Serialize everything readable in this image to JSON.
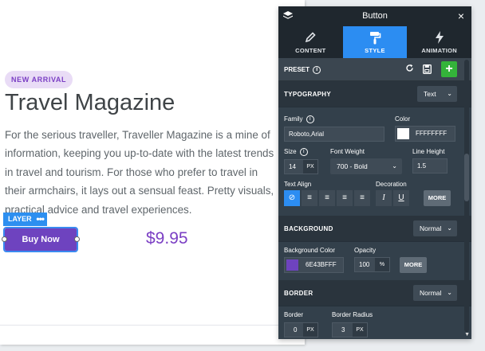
{
  "canvas": {
    "badge": "NEW ARRIVAL",
    "title": "Travel Magazine",
    "description": "For the serious traveller, Traveller Magazine is a mine of information, keeping you up-to-date with the latest trends in travel and tourism. For those who prefer to travel in their armchairs, it lays out a sensual feast. Pretty visuals, practical advice and travel experiences.",
    "layer_label": "LAYER",
    "layer_dots": "•••",
    "button_label": "Buy Now",
    "price": "$9.95"
  },
  "panel": {
    "title": "Button",
    "close_icon": "×",
    "tabs": [
      {
        "label": "CONTENT",
        "icon": "pencil-icon"
      },
      {
        "label": "STYLE",
        "icon": "paint-roller-icon",
        "active": true
      },
      {
        "label": "ANIMATION",
        "icon": "bolt-icon"
      }
    ],
    "preset": {
      "label": "PRESET"
    },
    "typography": {
      "label": "TYPOGRAPHY",
      "mode": "Text",
      "family_label": "Family",
      "family_value": "Roboto,Arial",
      "color_label": "Color",
      "color_value": "FFFFFFFF",
      "color_hex": "#FFFFFF",
      "size_label": "Size",
      "size_value": "14",
      "size_unit": "PX",
      "weight_label": "Font Weight",
      "weight_value": "700 - Bold",
      "lineheight_label": "Line Height",
      "lineheight_value": "1.5",
      "align_label": "Text Align",
      "decoration_label": "Decoration",
      "more_label": "MORE"
    },
    "background": {
      "label": "BACKGROUND",
      "mode": "Normal",
      "color_label": "Background Color",
      "color_value": "6E43BFFF",
      "color_hex": "#6E43BF",
      "opacity_label": "Opacity",
      "opacity_value": "100",
      "opacity_unit": "%",
      "more_label": "MORE"
    },
    "border": {
      "label": "BORDER",
      "mode": "Normal",
      "border_label": "Border",
      "border_value": "0",
      "border_unit": "PX",
      "radius_label": "Border Radius",
      "radius_value": "3",
      "radius_unit": "PX"
    }
  },
  "colors": {
    "accent": "#2C8DF2",
    "brand_purple": "#6E43BF",
    "add_green": "#34B43A"
  }
}
